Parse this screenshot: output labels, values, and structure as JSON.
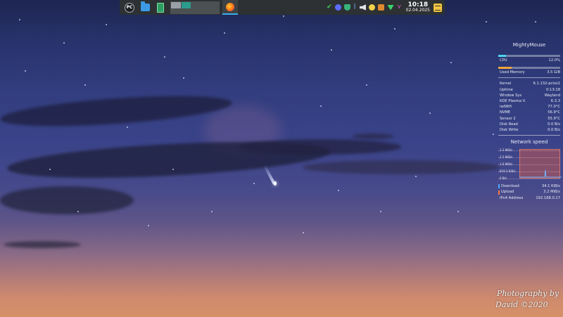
{
  "taskbar": {
    "launchers": [
      {
        "name": "pclinuxos-menu",
        "glyph": "PC"
      },
      {
        "name": "file-manager"
      },
      {
        "name": "spreadsheet"
      }
    ],
    "clock": {
      "time": "10:18",
      "date": "02.04.2025"
    }
  },
  "conky": {
    "hostname": "MightyMouse",
    "cpu": {
      "label": "CPU",
      "value": "12.0%",
      "fraction": 0.12,
      "color": "#4fd3ee"
    },
    "memory": {
      "label": "Used Memory",
      "value": "3.5 GiB",
      "fraction": 0.22,
      "color": "#f0a43c"
    },
    "stats": [
      {
        "label": "Kernel",
        "value": "6.1.132-pclos1"
      },
      {
        "label": "Uptime",
        "value": "0:13:18"
      },
      {
        "label": "Window Sys",
        "value": "Wayland"
      },
      {
        "label": "KDE Plasma V.",
        "value": "6.3.3"
      },
      {
        "label": "iwlWifi",
        "value": "77.0°C"
      },
      {
        "label": "NVME",
        "value": "56.9°C"
      },
      {
        "label": "Sensor 2",
        "value": "55.9°C"
      },
      {
        "label": "Disk Read",
        "value": "0.0 B/s"
      },
      {
        "label": "Disk Write",
        "value": "0.0 B/s"
      }
    ],
    "network": {
      "title": "Network speed",
      "graph_labels": [
        "3.3 MiB/s",
        "2.5 MiB/s",
        "1.6 MiB/s",
        "819.3 KiB/s",
        "0 B/s"
      ],
      "download": {
        "label": "Download",
        "value": "34.1 KiB/s",
        "color": "#4aa8ff"
      },
      "upload": {
        "label": "Upload",
        "value": "3.2 MiB/s",
        "color": "#ff7a45"
      },
      "ipv4": {
        "label": "IPv4 Address",
        "value": "192.168.0.17"
      }
    }
  },
  "watermark": {
    "line1": "Photography by",
    "line2": "David ©2020"
  }
}
